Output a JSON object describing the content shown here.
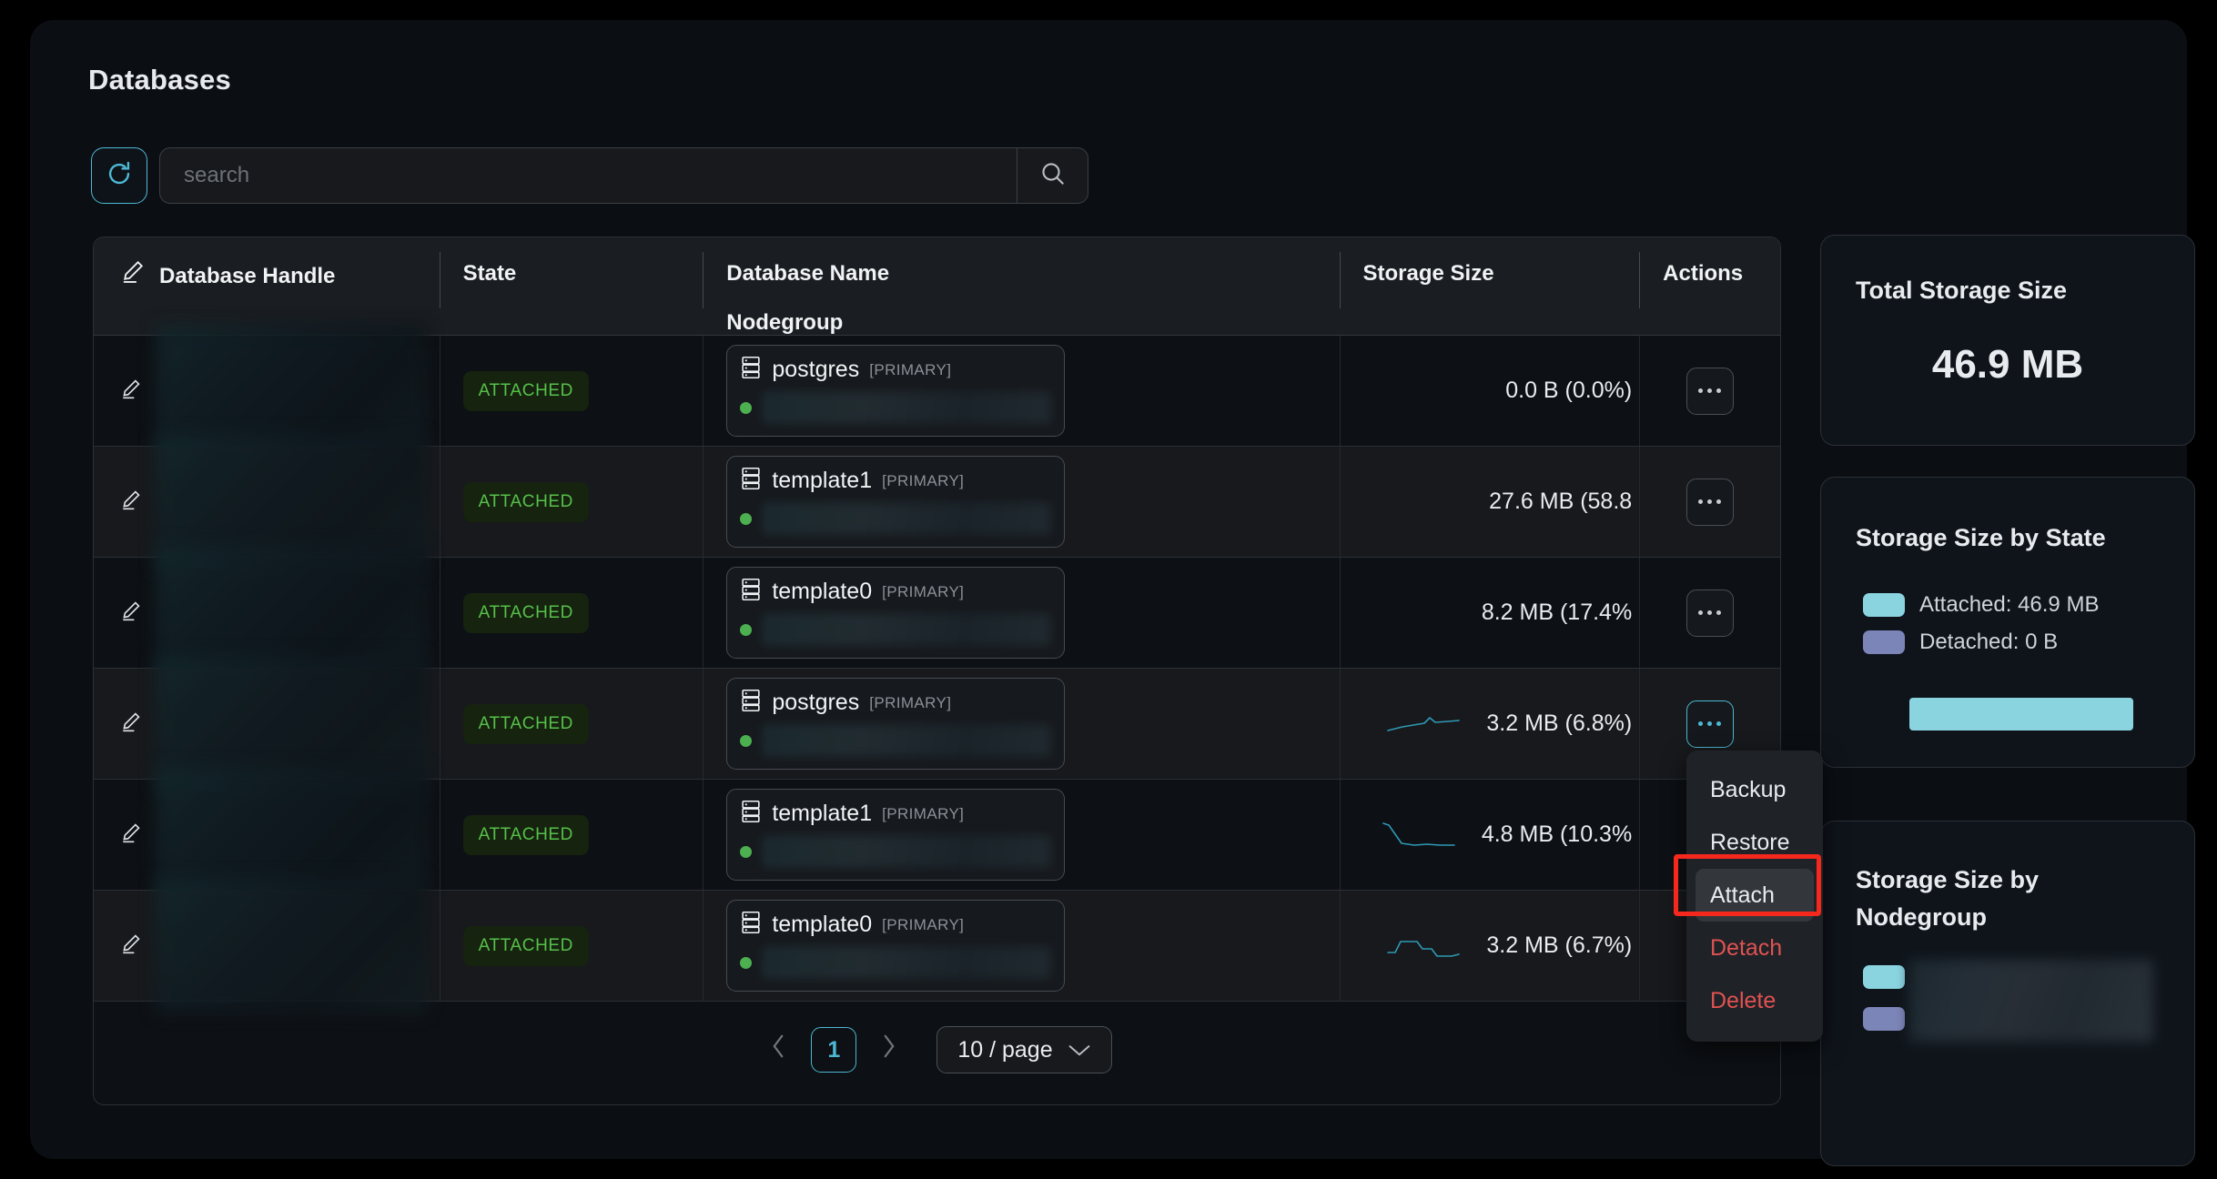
{
  "page": {
    "title": "Databases"
  },
  "toolbar": {
    "refresh_icon": "refresh-icon",
    "search_placeholder": "search",
    "search_value": "",
    "search_icon": "search-icon"
  },
  "table": {
    "columns": {
      "handle_icon": "pencil-icon",
      "handle": "Database Handle",
      "state": "State",
      "name": "Database Name",
      "nodegroup": "Nodegroup",
      "storage": "Storage Size",
      "actions": "Actions"
    },
    "rows": [
      {
        "handle": "",
        "state": "ATTACHED",
        "db_name": "postgres",
        "db_tag": "[PRIMARY]",
        "nodegroup": "",
        "storage": "0.0 B  (0.0%)",
        "sparkline": null,
        "actions_active": false
      },
      {
        "handle": "",
        "state": "ATTACHED",
        "db_name": "template1",
        "db_tag": "[PRIMARY]",
        "nodegroup": "",
        "storage": "27.6 MB  (58.8",
        "sparkline": null,
        "actions_active": false
      },
      {
        "handle": "",
        "state": "ATTACHED",
        "db_name": "template0",
        "db_tag": "[PRIMARY]",
        "nodegroup": "",
        "storage": "8.2 MB  (17.4%",
        "sparkline": null,
        "actions_active": false
      },
      {
        "handle": "",
        "state": "ATTACHED",
        "db_name": "postgres",
        "db_tag": "[PRIMARY]",
        "nodegroup": "",
        "storage": "3.2 MB  (6.8%)",
        "sparkline": "18,26 34,22 46,20 58,18 64,12 70,17 84,16 96,15",
        "actions_active": true
      },
      {
        "handle": "",
        "state": "ATTACHED",
        "db_name": "template1",
        "db_tag": "[PRIMARY]",
        "nodegroup": "",
        "storage": "4.8 MB  (10.3%",
        "sparkline": "18,6 24,8 38,28 52,30 66,29 80,30 96,30",
        "actions_active": false
      },
      {
        "handle": "",
        "state": "ATTACHED",
        "db_name": "template0",
        "db_tag": "[PRIMARY]",
        "nodegroup": "",
        "storage": "3.2 MB  (6.7%)",
        "sparkline": "18,26 26,26 32,14 50,14 56,22 66,22 72,30 88,30 96,28",
        "actions_active": false
      }
    ]
  },
  "actions_menu": {
    "items": [
      {
        "label": "Backup",
        "danger": false,
        "hovered": false
      },
      {
        "label": "Restore",
        "danger": false,
        "hovered": false
      },
      {
        "label": "Attach",
        "danger": false,
        "hovered": true
      },
      {
        "label": "Detach",
        "danger": true,
        "hovered": false
      },
      {
        "label": "Delete",
        "danger": true,
        "hovered": false
      }
    ],
    "highlight_color": "#f5281e"
  },
  "pagination": {
    "prev_icon": "chevron-left-icon",
    "next_icon": "chevron-right-icon",
    "current_page": "1",
    "page_size": "10 / page",
    "chevron_icon": "chevron-down-icon"
  },
  "sidebar": {
    "total_card": {
      "title": "Total Storage Size",
      "value": "46.9 MB"
    },
    "state_card": {
      "title": "Storage Size by State",
      "legend": [
        {
          "label": "Attached:  46.9 MB",
          "color": "#8ad4e0"
        },
        {
          "label": "Detached:  0 B",
          "color": "#7c85b8"
        }
      ],
      "bar_color": "#8ad4e0"
    },
    "nodegroup_card": {
      "title": "Storage Size by Nodegroup",
      "legend": [
        {
          "label": "",
          "color": "#8ad4e0"
        },
        {
          "label": "",
          "color": "#7c85b8"
        }
      ]
    }
  },
  "colors": {
    "accent": "#4db8d4",
    "attached_text": "#56c04a",
    "attached_bg": "#16230f",
    "danger": "#e05252",
    "sparkline": "#2f99b5",
    "panel_bg": "#0b0f14"
  }
}
